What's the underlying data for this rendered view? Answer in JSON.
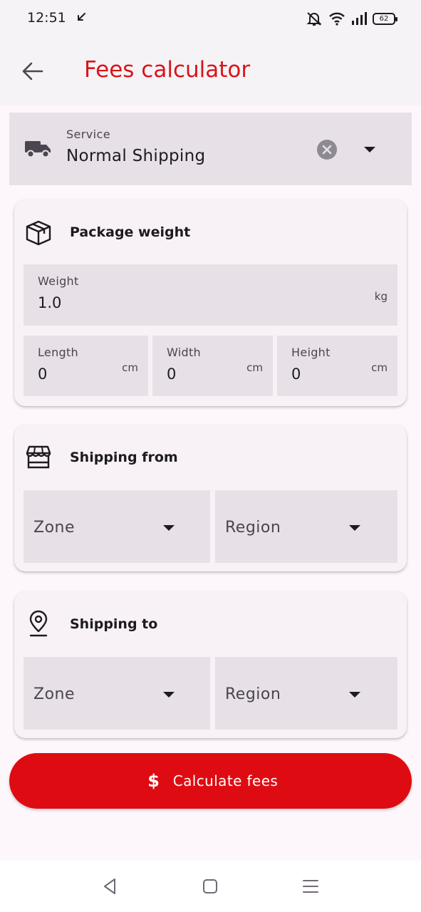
{
  "status_bar": {
    "time": "12:51",
    "battery": "62"
  },
  "app_bar": {
    "title": "Fees calculator",
    "back_icon": "arrow-back-icon"
  },
  "service": {
    "label": "Service",
    "value": "Normal Shipping",
    "icon": "truck-icon"
  },
  "package": {
    "title": "Package weight",
    "icon": "package-box-icon",
    "weight": {
      "label": "Weight",
      "value": "1.0",
      "unit": "kg"
    },
    "length": {
      "label": "Length",
      "value": "0",
      "unit": "cm"
    },
    "width": {
      "label": "Width",
      "value": "0",
      "unit": "cm"
    },
    "height": {
      "label": "Height",
      "value": "0",
      "unit": "cm"
    }
  },
  "shipping_from": {
    "title": "Shipping from",
    "icon": "storefront-icon",
    "zone": "Zone",
    "region": "Region"
  },
  "shipping_to": {
    "title": "Shipping to",
    "icon": "location-pin-icon",
    "zone": "Zone",
    "region": "Region"
  },
  "calculate_button": {
    "icon_glyph": "$",
    "label": "Calculate fees"
  },
  "colors": {
    "accent": "#de0c12",
    "title": "#d8151b",
    "field_bg": "#e8e0e7",
    "card_bg": "#f8f2f7"
  }
}
